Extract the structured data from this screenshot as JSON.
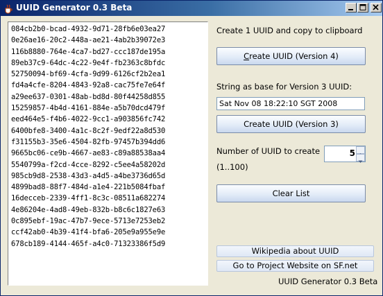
{
  "window": {
    "title": "UUID Generator 0.3 Beta",
    "accent_color": "#0a246a",
    "controls": [
      "minimize-icon",
      "maximize-icon",
      "close-icon"
    ]
  },
  "uuid_list": [
    "084cb2b0-bcad-4932-9d71-28fb6e03ea27",
    "0e26ae16-20c2-448a-ae21-4ab2b39072e3",
    "116b8880-764e-4ca7-bd27-ccc187de195a",
    "89eb37c9-64dc-4c22-9e4f-fb2363c8bfdc",
    "52750094-bf69-4cfa-9d99-6126cf2b2ea1",
    "fd4a4cfe-8204-4843-92a8-cac75fe7e64f",
    "a29ee637-0301-48ab-bd8d-80f44258d855",
    "15259857-4b4d-4161-884e-a5b70dcd479f",
    "eed464e5-f4b6-4022-9cc1-a903856fc742",
    "6400bfe8-3400-4a1c-8c2f-9edf22a8d530",
    "f31155b3-35e6-4504-82fb-97457b394dd6",
    "9665bc06-ce9b-4667-ae83-c89a88538aa4",
    "5540799a-f2cd-4cce-8292-c5ee4a58202d",
    "985cb9d8-2538-43d3-a4d5-a4be3736d65d",
    "4899bad8-88f7-484d-a1e4-221b5084fbaf",
    "16decceb-2339-4ff1-8c3c-08511a682274",
    "4e86204e-4ad8-49eb-832b-b8c6c1827e63",
    "0c895ebf-19ac-47b7-9ece-5713e7253eb2",
    "ccf42ab0-4b39-41f4-bfa6-205e9a955e9e",
    "678cb189-4144-465f-a4c0-71323386f5d9"
  ],
  "panel": {
    "copy_hint": "Create 1 UUID and copy to clipboard",
    "btn_v4": "Create UUID (Version 4)",
    "v3_base_label": "String as base for Version 3 UUID:",
    "v3_base_value": "Sat Nov 08 18:22:10 SGT 2008",
    "btn_v3": "Create UUID (Version 3)",
    "count_label_1": "Number of UUID to create",
    "count_label_2": "(1..100)",
    "count_value": "5",
    "btn_clear": "Clear List",
    "link_wikipedia": "Wikipedia about UUID",
    "link_project": "Go to Project Website on SF.net",
    "footer_version": "UUID Generator 0.3 Beta"
  }
}
